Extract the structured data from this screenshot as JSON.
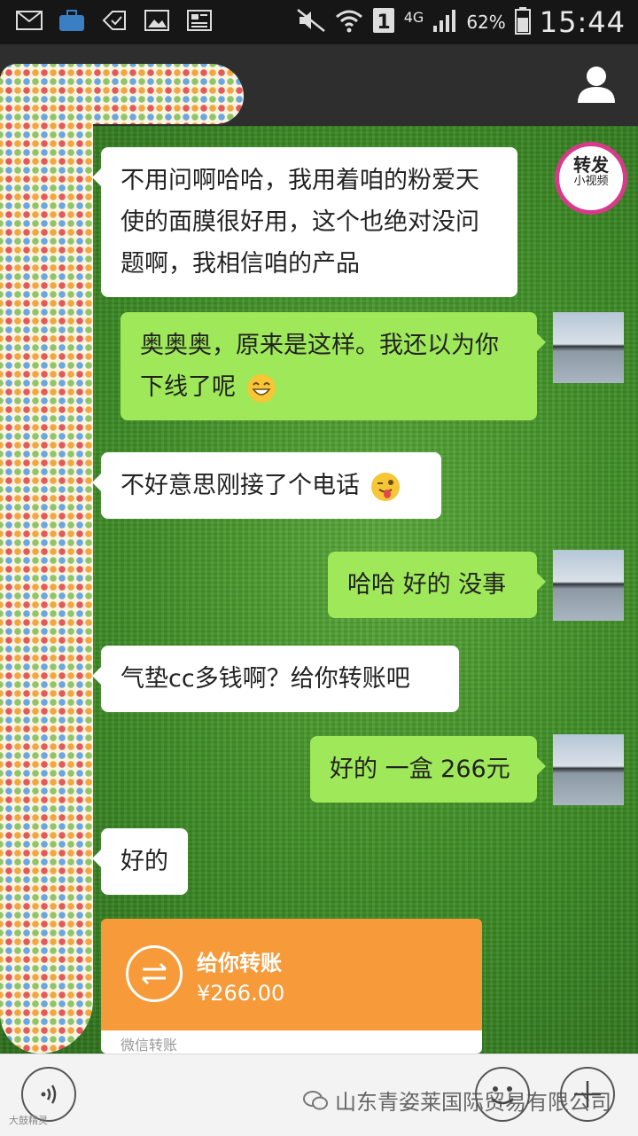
{
  "status_bar": {
    "signal_label": "4G",
    "battery": "62%",
    "time": "15:44"
  },
  "forward_badge": {
    "main": "转发",
    "sub": "小视频"
  },
  "messages": [
    {
      "side": "in",
      "text": "不用问啊哈哈，我用着咱的粉爱天使的面膜很好用，这个也绝对没问题啊，我相信咱的产品"
    },
    {
      "side": "out",
      "text": "奥奥奥，原来是这样。我还以为你下线了呢",
      "emoji": "grinning-emoji"
    },
    {
      "side": "in",
      "text": "不好意思刚接了个电话",
      "emoji": "tongue-wink-emoji"
    },
    {
      "side": "out",
      "text": "哈哈 好的 没事"
    },
    {
      "side": "in",
      "text": "气垫cc多钱啊？给你转账吧"
    },
    {
      "side": "out",
      "text": "好的 一盒 266元"
    },
    {
      "side": "in",
      "text": "好的"
    }
  ],
  "transfer_card": {
    "title": "给你转账",
    "amount": "¥266.00",
    "footer": "微信转账"
  },
  "bottom_bar": {
    "watermark": "山东青姿莱国际贸易有限公司",
    "small_watermark": "大鼓精灵"
  },
  "colors": {
    "incoming_bubble": "#ffffff",
    "outgoing_bubble": "#9ee85a",
    "transfer_card": "#f69a3a",
    "chat_background": "#3f8f27"
  }
}
